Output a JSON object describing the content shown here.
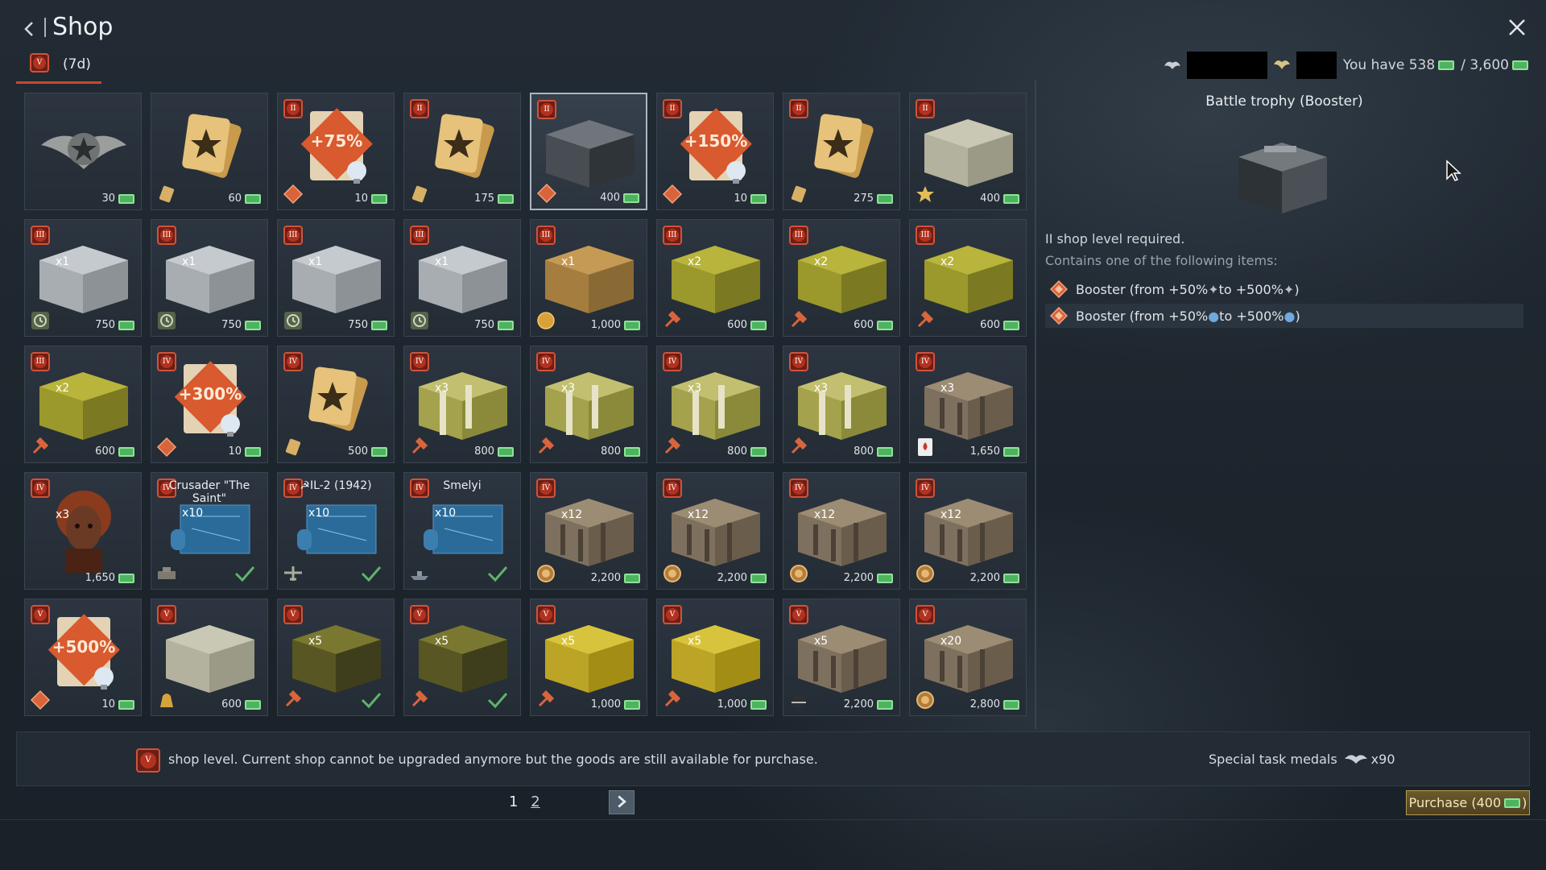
{
  "header": {
    "title": "Shop",
    "tab_level": "V",
    "tab_label": "(7d)",
    "balance_label": "You have 538",
    "balance_total": "/ 3,600"
  },
  "grid": {
    "rows": [
      [
        {
          "lvl": "",
          "price": "30",
          "art": "emblem",
          "icon": ""
        },
        {
          "lvl": "",
          "price": "60",
          "art": "card",
          "icon": "card"
        },
        {
          "lvl": "II",
          "price": "10",
          "art": "boost",
          "label": "+75%",
          "icon": "diamond"
        },
        {
          "lvl": "II",
          "price": "175",
          "art": "card",
          "icon": "card"
        },
        {
          "lvl": "II",
          "price": "400",
          "art": "darkbox",
          "icon": "diamond",
          "selected": true
        },
        {
          "lvl": "II",
          "price": "10",
          "art": "boost",
          "label": "+150%",
          "icon": "diamond"
        },
        {
          "lvl": "II",
          "price": "275",
          "art": "card",
          "icon": "card"
        },
        {
          "lvl": "II",
          "price": "400",
          "art": "beigebox",
          "icon": "star"
        }
      ],
      [
        {
          "lvl": "III",
          "price": "750",
          "art": "silverbox",
          "count": "x1",
          "icon": "clock"
        },
        {
          "lvl": "III",
          "price": "750",
          "art": "silverbox",
          "count": "x1",
          "icon": "clock"
        },
        {
          "lvl": "III",
          "price": "750",
          "art": "silverbox",
          "count": "x1",
          "icon": "clock"
        },
        {
          "lvl": "III",
          "price": "750",
          "art": "silverbox",
          "count": "x1",
          "icon": "clock"
        },
        {
          "lvl": "III",
          "price": "1,000",
          "art": "brownbox",
          "count": "x1",
          "icon": "coin"
        },
        {
          "lvl": "III",
          "price": "600",
          "art": "greenbox",
          "count": "x2",
          "icon": "hammer"
        },
        {
          "lvl": "III",
          "price": "600",
          "art": "greenbox",
          "count": "x2",
          "icon": "hammer"
        },
        {
          "lvl": "III",
          "price": "600",
          "art": "greenbox",
          "count": "x2",
          "icon": "hammer"
        }
      ],
      [
        {
          "lvl": "III",
          "price": "600",
          "art": "greenbox",
          "count": "x2",
          "icon": "hammer"
        },
        {
          "lvl": "IV",
          "price": "10",
          "art": "boost",
          "label": "+300%",
          "icon": "diamond"
        },
        {
          "lvl": "IV",
          "price": "500",
          "art": "card",
          "icon": "card"
        },
        {
          "lvl": "IV",
          "price": "800",
          "art": "stripebox",
          "count": "x3",
          "icon": "hammer"
        },
        {
          "lvl": "IV",
          "price": "800",
          "art": "stripebox",
          "count": "x3",
          "icon": "hammer"
        },
        {
          "lvl": "IV",
          "price": "800",
          "art": "stripebox",
          "count": "x3",
          "icon": "hammer"
        },
        {
          "lvl": "IV",
          "price": "800",
          "art": "stripebox",
          "count": "x3",
          "icon": "hammer"
        },
        {
          "lvl": "IV",
          "price": "1,650",
          "art": "crate",
          "count": "x3",
          "icon": "ace"
        }
      ],
      [
        {
          "lvl": "IV",
          "price": "1,650",
          "art": "portrait",
          "count": "x3",
          "icon": ""
        },
        {
          "lvl": "IV",
          "price": "",
          "art": "blueprint",
          "name": "Crusader \"The Saint\"",
          "count": "x10",
          "icon": "tank",
          "check": true
        },
        {
          "lvl": "IV",
          "price": "",
          "art": "blueprint",
          "name": "☭IL-2 (1942)",
          "count": "x10",
          "icon": "plane",
          "check": true
        },
        {
          "lvl": "IV",
          "price": "",
          "art": "blueprint",
          "name": "Smelyi",
          "count": "x10",
          "icon": "ship",
          "check": true
        },
        {
          "lvl": "IV",
          "price": "2,200",
          "art": "crate",
          "count": "x12",
          "icon": "medal"
        },
        {
          "lvl": "IV",
          "price": "2,200",
          "art": "crate",
          "count": "x12",
          "icon": "medal"
        },
        {
          "lvl": "IV",
          "price": "2,200",
          "art": "crate",
          "count": "x12",
          "icon": "medal"
        },
        {
          "lvl": "IV",
          "price": "2,200",
          "art": "crate",
          "count": "x12",
          "icon": "medal"
        }
      ],
      [
        {
          "lvl": "V",
          "price": "10",
          "art": "boost",
          "label": "+500%",
          "icon": "diamond"
        },
        {
          "lvl": "V",
          "price": "600",
          "art": "beigebox",
          "icon": "bag"
        },
        {
          "lvl": "V",
          "price": "",
          "art": "darkgreenbox",
          "count": "x5",
          "icon": "hammer",
          "check": true
        },
        {
          "lvl": "V",
          "price": "",
          "art": "darkgreenbox",
          "count": "x5",
          "icon": "hammer",
          "check": true
        },
        {
          "lvl": "V",
          "price": "1,000",
          "art": "yellowbox",
          "count": "x5",
          "icon": "hammer"
        },
        {
          "lvl": "V",
          "price": "1,000",
          "art": "yellowbox",
          "count": "x5",
          "icon": "hammer"
        },
        {
          "lvl": "V",
          "price": "2,200",
          "art": "crate",
          "count": "x5",
          "icon": "helmet"
        },
        {
          "lvl": "V",
          "price": "2,800",
          "art": "crate",
          "count": "x20",
          "icon": "medal"
        }
      ]
    ]
  },
  "details": {
    "title": "Battle trophy (Booster)",
    "requirement": "II shop level required.",
    "contains": "Contains one of the following items:",
    "rewards": [
      {
        "text_pre": "Booster (from +50%",
        "text_mid": " to +500%",
        "text_post": ")"
      },
      {
        "text_pre": "Booster (from +50%",
        "text_mid": " to +500%",
        "text_post": ")"
      }
    ]
  },
  "footer": {
    "level": "V",
    "info_text": "shop level. Current shop cannot be upgraded anymore but the goods are still available for purchase.",
    "medals_label": "Special task medals",
    "medals_count": "x90",
    "page1": "1",
    "page2": "2",
    "purchase_label": "Purchase (400",
    "purchase_suffix": ")"
  },
  "colors": {
    "accent": "#c8482c",
    "gold": "#4db35e",
    "purchase": "#6c5a2b"
  }
}
